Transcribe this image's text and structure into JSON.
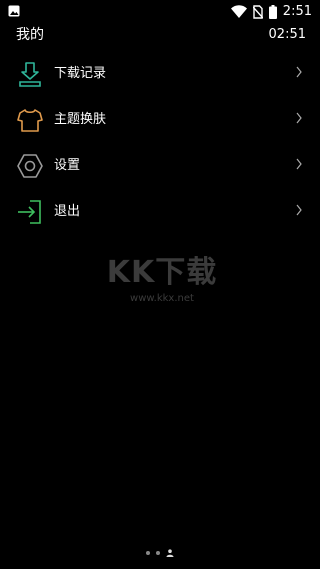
{
  "status_bar": {
    "time": "2:51",
    "icons": [
      "image-icon",
      "wifi-icon",
      "no-sim-icon",
      "battery-icon"
    ]
  },
  "header": {
    "title": "我的",
    "clock": "02:51"
  },
  "menu": {
    "items": [
      {
        "label": "下载记录",
        "icon": "download-icon",
        "color": "#2fb69a"
      },
      {
        "label": "主题换肤",
        "icon": "shirt-icon",
        "color": "#e09a4c"
      },
      {
        "label": "设置",
        "icon": "hexagon-settings-icon",
        "color": "#9a9a9a"
      },
      {
        "label": "退出",
        "icon": "logout-icon",
        "color": "#3fbf5f"
      }
    ]
  },
  "watermark": {
    "logo": "KK下载",
    "url": "www.kkx.net"
  },
  "pager": {
    "pages": 3,
    "current": 3
  }
}
